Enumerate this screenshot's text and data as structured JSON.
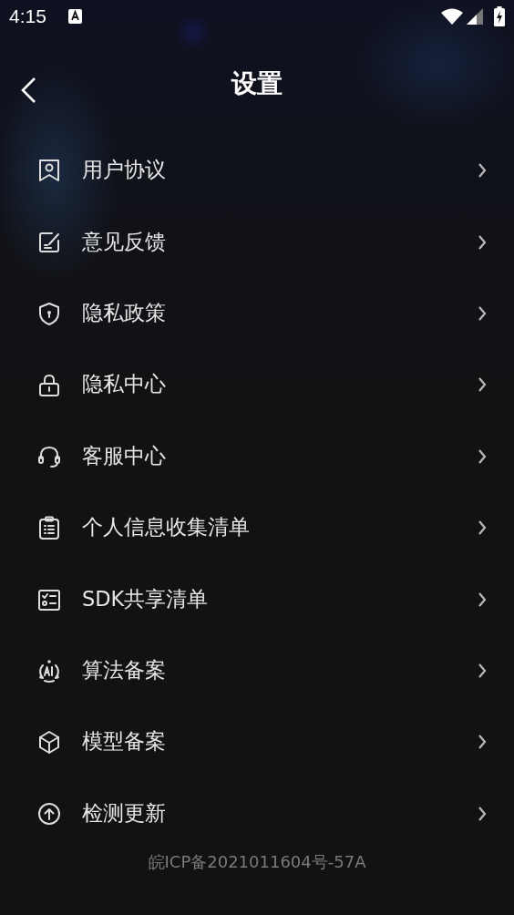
{
  "status_bar": {
    "time": "4:15"
  },
  "header": {
    "title": "设置"
  },
  "items": [
    {
      "label": "用户协议",
      "kind": "bookmark"
    },
    {
      "label": "意见反馈",
      "kind": "edit"
    },
    {
      "label": "隐私政策",
      "kind": "shield"
    },
    {
      "label": "隐私中心",
      "kind": "lock"
    },
    {
      "label": "客服中心",
      "kind": "headset"
    },
    {
      "label": "个人信息收集清单",
      "kind": "clipboard"
    },
    {
      "label": "SDK共享清单",
      "kind": "checklist"
    },
    {
      "label": "算法备案",
      "kind": "ai"
    },
    {
      "label": "模型备案",
      "kind": "cube"
    },
    {
      "label": "检测更新",
      "kind": "upload"
    }
  ],
  "footer": {
    "text": "皖ICP备2021011604号-57A"
  }
}
